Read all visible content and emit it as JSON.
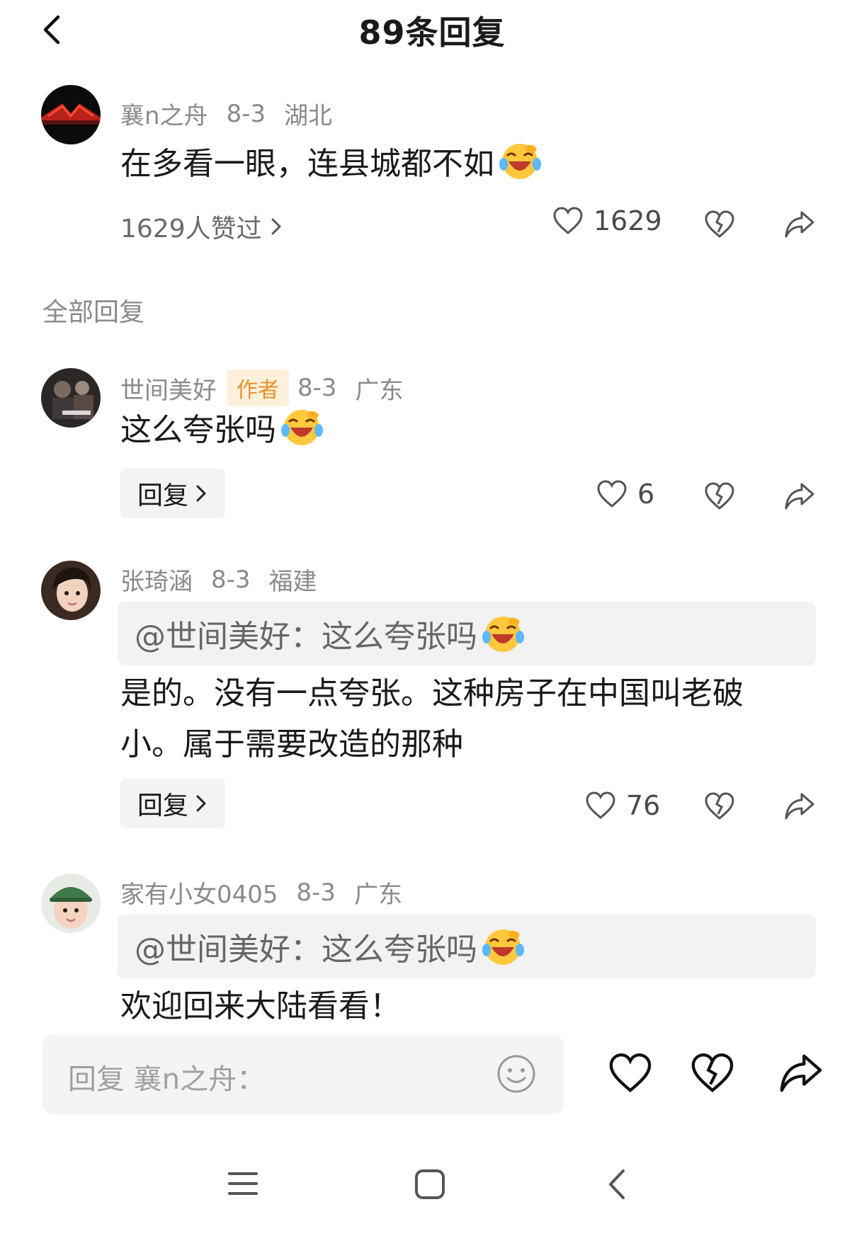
{
  "header": {
    "title": "89条回复"
  },
  "main_comment": {
    "username": "襄n之舟",
    "date": "8-3",
    "location": "湖北",
    "text": "在多看一眼，连县城都不如",
    "likes_link": "1629人赞过",
    "like_count": "1629"
  },
  "section_label": "全部回复",
  "replies": [
    {
      "username": "世间美好",
      "badge": "作者",
      "date": "8-3",
      "location": "广东",
      "text": "这么夸张吗",
      "reply_label": "回复",
      "like_count": "6"
    },
    {
      "username": "张琦涵",
      "date": "8-3",
      "location": "福建",
      "quote": "@世间美好：这么夸张吗",
      "text_line1": "是的。没有一点夸张。这种房子在中国叫老破",
      "text_line2": "小。属于需要改造的那种",
      "reply_label": "回复",
      "like_count": "76"
    },
    {
      "username": "家有小女0405",
      "date": "8-3",
      "location": "广东",
      "quote": "@世间美好：这么夸张吗",
      "text": "欢迎回来大陆看看！"
    }
  ],
  "composer": {
    "placeholder": "回复 襄n之舟："
  },
  "icons": {
    "back": "chevron-left-icon",
    "like": "heart-outline-icon",
    "dislike": "broken-heart-icon",
    "share": "share-arrow-icon",
    "emoji": "laughing-tears-emoji",
    "smiley": "smiley-icon",
    "nav_menu": "menu-icon",
    "nav_home": "square-home-icon",
    "nav_back": "chevron-left-icon"
  },
  "colors": {
    "badge_bg": "#fdf1dc",
    "badge_text": "#e8912c",
    "meta": "#8a8a8a"
  }
}
